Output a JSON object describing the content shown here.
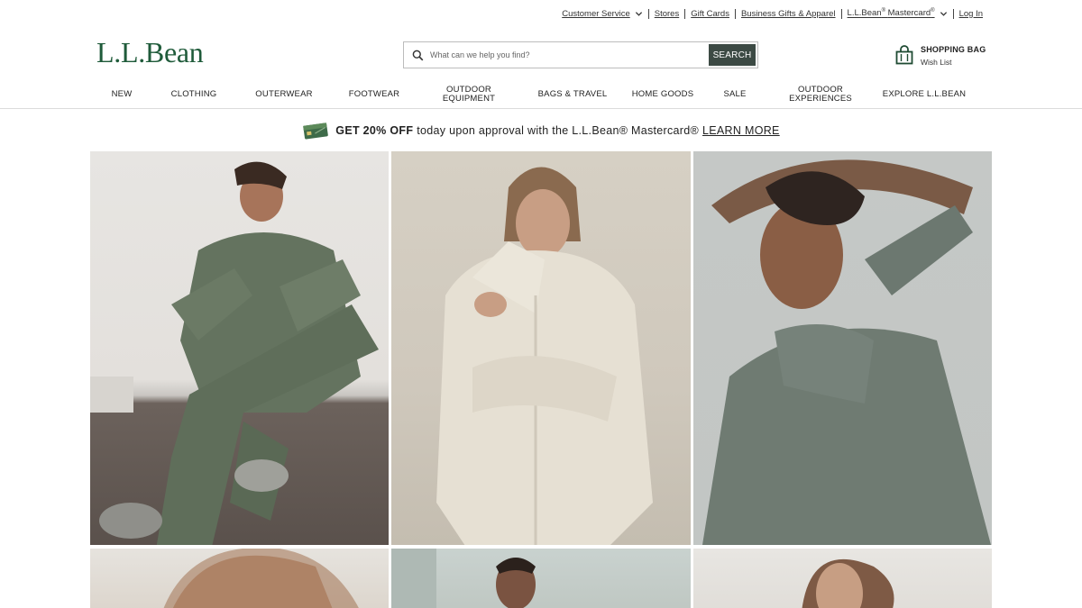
{
  "utility": {
    "customer_service": "Customer Service",
    "stores": "Stores",
    "gift_cards": "Gift Cards",
    "business_gifts": "Business Gifts & Apparel",
    "mastercard_pre": "L.L.Bean",
    "mastercard_mid": "Mastercard",
    "log_in": "Log In"
  },
  "header": {
    "logo": "L.L.Bean",
    "search_placeholder": "What can we help you find?",
    "search_button": "SEARCH",
    "bag_title": "SHOPPING BAG",
    "wish_list": "Wish List"
  },
  "nav": {
    "items": [
      {
        "label": "NEW"
      },
      {
        "label": "CLOTHING"
      },
      {
        "label": "OUTERWEAR"
      },
      {
        "label": "FOOTWEAR"
      },
      {
        "label1": "OUTDOOR",
        "label2": "EQUIPMENT"
      },
      {
        "label": "BAGS & TRAVEL"
      },
      {
        "label": "HOME GOODS"
      },
      {
        "label": "SALE"
      },
      {
        "label1": "OUTDOOR",
        "label2": "EXPERIENCES"
      },
      {
        "label": "EXPLORE L.L.BEAN"
      }
    ]
  },
  "promo": {
    "bold": "GET 20% OFF",
    "text": "today upon approval with the L.L.Bean® Mastercard®",
    "link": "LEARN MORE"
  },
  "colors": {
    "brand_green": "#1f5b3a",
    "search_button": "#3c4a44"
  }
}
